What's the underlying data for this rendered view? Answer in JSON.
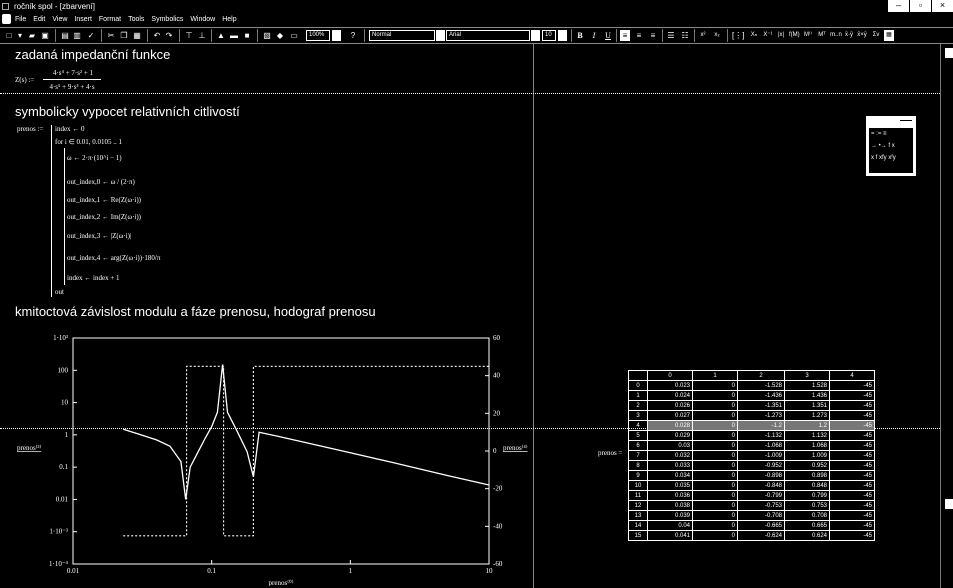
{
  "window": {
    "title": "ročník spol - [zbarvení]",
    "controls": [
      "–",
      "▫",
      "×"
    ]
  },
  "menu": [
    "File",
    "Edit",
    "View",
    "Insert",
    "Format",
    "Tools",
    "Symbolics",
    "Window",
    "Help"
  ],
  "toolbar": {
    "zoom": "100%",
    "style": "Normal",
    "font": "Arial",
    "size": "10",
    "bold": "B",
    "italic": "I",
    "underline": "U"
  },
  "sections": {
    "h1": "zadaná impedanční funkce",
    "h2": "symbolicky vypocet relativních citlivostí",
    "h3": "kmitoctová závislost modulu a fáze prenosu, hodograf prenosu"
  },
  "formula": {
    "lhs": "Z(s) :=",
    "num": "4·s⁴ + 7·s² + 1",
    "den": "4·s⁵ + 9·s³ + 4·s"
  },
  "program": {
    "name": "prenos :=",
    "lines": [
      "index ← 0",
      "for  i ∈ 0.01, 0.0105 .. 1",
      "ω ← 2·π·(10^i − 1)",
      "out_index,0 ← ω / (2·π)",
      "out_index,1 ← Re(Z(ω·i))",
      "out_index,2 ← Im(Z(ω·i))",
      "out_index,3 ← |Z(ω·i)|",
      "out_index,4 ← arg(Z(ω·i))·180/π",
      "index ← index + 1",
      "out"
    ]
  },
  "palette": {
    "row1": "=  :=  ≡",
    "row2": "→  •→  f x",
    "row3": "x f  xfy  xᶠy"
  },
  "table": {
    "label": "prenos =",
    "headers": [
      "0",
      "1",
      "2",
      "3",
      "4"
    ],
    "rows": [
      [
        "0",
        "0.023",
        "0",
        "-1.528",
        "1.528",
        "-45"
      ],
      [
        "1",
        "0.024",
        "0",
        "-1.436",
        "1.436",
        "-45"
      ],
      [
        "2",
        "0.026",
        "0",
        "-1.351",
        "1.351",
        "-45"
      ],
      [
        "3",
        "0.027",
        "0",
        "-1.273",
        "1.273",
        "-45"
      ],
      [
        "4",
        "0.028",
        "0",
        "-1.2",
        "1.2",
        "-45"
      ],
      [
        "5",
        "0.029",
        "0",
        "-1.132",
        "1.132",
        "-45"
      ],
      [
        "6",
        "0.03",
        "0",
        "-1.068",
        "1.068",
        "-45"
      ],
      [
        "7",
        "0.032",
        "0",
        "-1.009",
        "1.009",
        "-45"
      ],
      [
        "8",
        "0.033",
        "0",
        "-0.952",
        "0.952",
        "-45"
      ],
      [
        "9",
        "0.034",
        "0",
        "-0.898",
        "0.898",
        "-45"
      ],
      [
        "10",
        "0.035",
        "0",
        "-0.848",
        "0.848",
        "-45"
      ],
      [
        "11",
        "0.036",
        "0",
        "-0.799",
        "0.799",
        "-45"
      ],
      [
        "12",
        "0.038",
        "0",
        "-0.753",
        "0.753",
        "-45"
      ],
      [
        "13",
        "0.039",
        "0",
        "-0.708",
        "0.708",
        "-45"
      ],
      [
        "14",
        "0.04",
        "0",
        "-0.665",
        "0.665",
        "-45"
      ],
      [
        "15",
        "0.041",
        "0",
        "-0.624",
        "0.624",
        "-45"
      ]
    ]
  },
  "chart_data": {
    "type": "line",
    "xscale": "log",
    "yscale_left": "log",
    "xlim": [
      0.01,
      10
    ],
    "ylim_left": [
      0.0001,
      1000
    ],
    "ylim_right": [
      -60,
      60
    ],
    "xticks": [
      "0.01",
      "0.1",
      "1",
      "10"
    ],
    "yticks_left": [
      "1·10⁻⁴",
      "1·10⁻³",
      "0.01",
      "0.1",
      "1",
      "10",
      "100",
      "1·10³"
    ],
    "yticks_right": [
      "-60",
      "-40",
      "-20",
      "0",
      "20",
      "40",
      "60"
    ],
    "xlabel": "prenos⁽⁰⁾",
    "ylabel_left": "prenos⁽³⁾",
    "ylabel_right": "prenos⁽⁴⁾",
    "series": [
      {
        "name": "prenos⁽³⁾",
        "axis": "left",
        "style": "solid",
        "x": [
          0.023,
          0.03,
          0.04,
          0.05,
          0.06,
          0.065,
          0.07,
          0.08,
          0.09,
          0.1,
          0.11,
          0.12,
          0.13,
          0.15,
          0.18,
          0.2,
          0.22,
          0.3,
          0.5,
          1,
          2,
          5,
          10
        ],
        "y": [
          1.5,
          1.05,
          0.7,
          0.45,
          0.15,
          0.01,
          0.1,
          0.3,
          0.8,
          1.8,
          5,
          150,
          5,
          1.5,
          0.3,
          0.05,
          1.2,
          0.9,
          0.55,
          0.28,
          0.14,
          0.055,
          0.028
        ]
      },
      {
        "name": "prenos⁽⁴⁾",
        "axis": "right",
        "style": "dotted",
        "x": [
          0.023,
          0.066,
          0.066,
          0.122,
          0.122,
          0.2,
          0.2,
          10
        ],
        "y": [
          -45,
          -45,
          45,
          45,
          -45,
          -45,
          45,
          45
        ]
      }
    ]
  }
}
